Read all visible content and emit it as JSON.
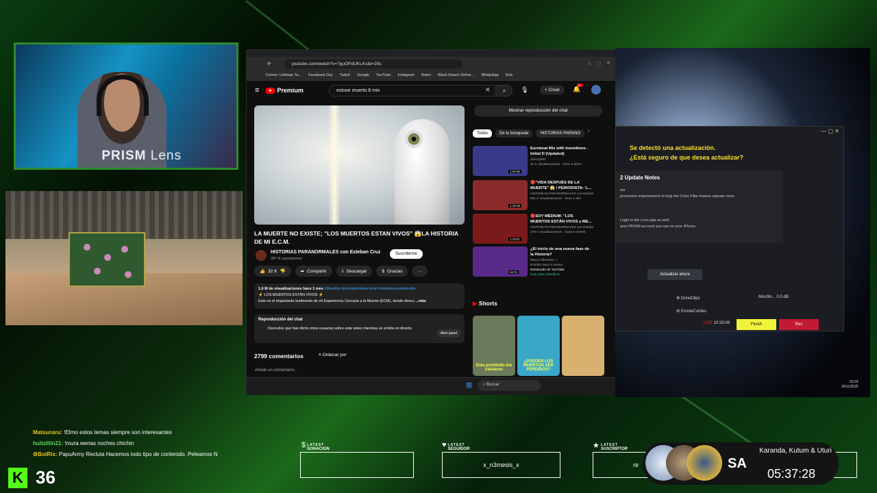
{
  "webcam": {
    "brand": "PRISM",
    "brand_suffix": "Lens"
  },
  "browser": {
    "url": "youtube.com/watch?v=7guOPdUKLKs&t=29s",
    "bookmarks": [
      "Correo: Unitman Ta...",
      "Facebook Dez",
      "Twitch",
      "Google",
      "YouTube",
      "Instagram",
      "Botrix",
      "Black Desert Online...",
      "WhatsApp",
      "Kick"
    ]
  },
  "youtube": {
    "logo": "Premium",
    "search_value": "estuve muerto 8 min",
    "create_label": "Crear",
    "notif_count": "9+",
    "video_title": "LA MUERTE NO EXISTE; \"LOS MUERTOS ESTAN VIVOS\" 😱LA HISTORIA DE MI E.C.M.",
    "channel": "HISTORIAS PARANORMALES con Esteban Cruz",
    "subs": "397 K suscriptores",
    "subscribe": "Suscribirme",
    "likes": "32 K",
    "share": "Compartir",
    "download": "Descargar",
    "thanks": "Gracias",
    "desc_stats": "1,6 M de visualizaciones  hace 1 mes",
    "desc_tags": "#MásAllá #podcastmotivacional #vidadespuesdelavida",
    "desc_line2": "⚡ LOS MUERTOS ESTÁN VIVOS ⚡",
    "desc_line3": "Este es el impactante testimonio de mi Experiencia Cercana a la Muerte (ECM), donde descu",
    "desc_more": "...más",
    "chat_title": "Reproducción del chat",
    "chat_text": "Descubre qué han dicho otros usuarios sobre este video mientras se emitía en directo.",
    "open_panel": "Abrir panel",
    "comments": "2799 comentarios",
    "order": "Ordenar por",
    "add_comment": "Añade un comentario...",
    "chat_replay_btn": "Mostrar reproducción del chat",
    "chips": [
      "Todos",
      "De tu búsqueda",
      "HISTORIAS PARANO"
    ],
    "recs": [
      {
        "title": "Eurobeat Mix with transitions - Initial D (Updated)",
        "channel": "JimcoyMG",
        "meta": "51 K visualizaciones · hace 2 años",
        "dur": "1:05:06",
        "color": "#3a3a8a"
      },
      {
        "title": "🔴\"VIDA DESPUÉS DE LA MUERTE\" 😱 / PERIODISTA: 'L...",
        "channel": "HISTORIAS PARANORMALES con Esteba",
        "meta": "881 K visualizaciones · hace 1 año",
        "dur": "1:18:35",
        "color": "#8a2a2a"
      },
      {
        "title": "🔴SOY MÉDIUM: \"LOS MUERTOS ESTÁN VIVOS y ME...",
        "channel": "HISTORIAS PARANORMALES con Esteba",
        "meta": "479 K visualizaciones · hace 5 meses",
        "dur": "1:10:57",
        "color": "#7a1a1a"
      },
      {
        "title": "¿El inicio de una nueva fase de la Historia?",
        "channel": "Marco Sifuentes ✓",
        "meta": "Emitido hace 9 meses",
        "extra": "Destacado de YouTube",
        "extra2": "Solo para miembros",
        "dur": "54:01",
        "color": "#5a2a8a"
      }
    ],
    "shorts_title": "Shorts",
    "shorts": [
      {
        "text": "Esta prohibido los celulares",
        "color": "#6a7a5a"
      },
      {
        "text": "¿PUEDEN LOS MUERTOS SER PERDIDOS?",
        "color": "#3aa6c8"
      },
      {
        "text": "",
        "color": "#d8b070"
      }
    ],
    "taskbar_search": "Buscar"
  },
  "updater": {
    "title1": "Se detectó una actualización.",
    "title2": "¿Está seguro de que desea actualizar?",
    "notes_title": "2 Update Notes",
    "notes_l1": "nts",
    "notes_l2": "preventive improvement to help the Color Filter feature operate more",
    "notes_l3": "Login in the Lens app as well.",
    "notes_l4": "ame PRISM account you use on your iPhone.",
    "update_btn": "Actualizar ahora",
    "source1": "DonoClips",
    "source2": "EmoteCombo",
    "mic_label": "Micrófo...",
    "mic_db": "0.0 dB",
    "live": "LIVE",
    "live_time": "10:33:06",
    "finish": "Finish",
    "rec": "Rec"
  },
  "clock": {
    "time": "03:24",
    "date": "26/11/2025"
  },
  "chat": [
    {
      "user": "Matsunaru:",
      "msg": "!Elmo estos temas siempre son interesantes",
      "style": "u"
    },
    {
      "user": "huitzillin21:",
      "msg": "!mura wenas noches chichin",
      "style": "u2"
    },
    {
      "user": "⚙BotRix:",
      "msg": "PapuArmy Recluta Hacemos todo tipo de contenido. Peleamos N",
      "style": "u"
    }
  ],
  "kick_count": "36",
  "overlay": {
    "donation": {
      "top": "LATEST",
      "label": "DONACION",
      "value": ""
    },
    "follower": {
      "top": "LATEST",
      "label": "SEGUIDOR",
      "value": "x_n3mesis_x"
    },
    "sub": {
      "top": "LATEST",
      "label": "SUSCRIPTOR",
      "value": "re"
    }
  },
  "raid": {
    "tag": "SA",
    "names": "Karanda, Kutum & Uturi",
    "time": "05:37:28"
  },
  "colors": {
    "accent_green": "#53fc18",
    "frame_green": "#2e8b2e",
    "yt_red": "#ff0000",
    "finish_yellow": "#f1f33a",
    "rec_red": "#c21a35"
  }
}
